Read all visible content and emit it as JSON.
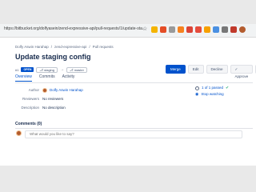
{
  "browser": {
    "url": "https://bitbucket.org/dolfyasein/zend-expressive-api/pull-requests/1/update-sta...",
    "icon_colors": [
      "#f4b400",
      "#e44d26",
      "#999999",
      "#f6821f",
      "#db4437",
      "#e54c3c",
      "#f7a000",
      "#4a90e2",
      "#777777",
      "#c0392b",
      "#b35c2e"
    ]
  },
  "breadcrumb": {
    "owner": "Dolfy Aswin Harahap",
    "repo": "zend-expressive-api",
    "section": "Pull requests"
  },
  "pull_request": {
    "title": "Update staging config",
    "number": "#1",
    "state": "OPEN",
    "source_branch": "staging",
    "target_branch": "master"
  },
  "actions": {
    "merge": "Merge",
    "edit": "Edit",
    "decline": "Decline",
    "approve": "Approve",
    "more": "⋮"
  },
  "tabs": [
    "Overview",
    "Commits",
    "Activity"
  ],
  "details": {
    "author_label": "Author",
    "author_value": "Dolfy Aswin Harahap",
    "reviewers_label": "Reviewers",
    "reviewers_value": "No reviewers",
    "description_label": "Description",
    "description_value": "No description"
  },
  "side": {
    "build_status": "1 of 1 passed",
    "watch": "Stop watching"
  },
  "comments": {
    "title": "Comments (0)",
    "placeholder": "What would you like to say?"
  },
  "colors": {
    "accent": "#0052cc",
    "success": "#36b37e"
  }
}
